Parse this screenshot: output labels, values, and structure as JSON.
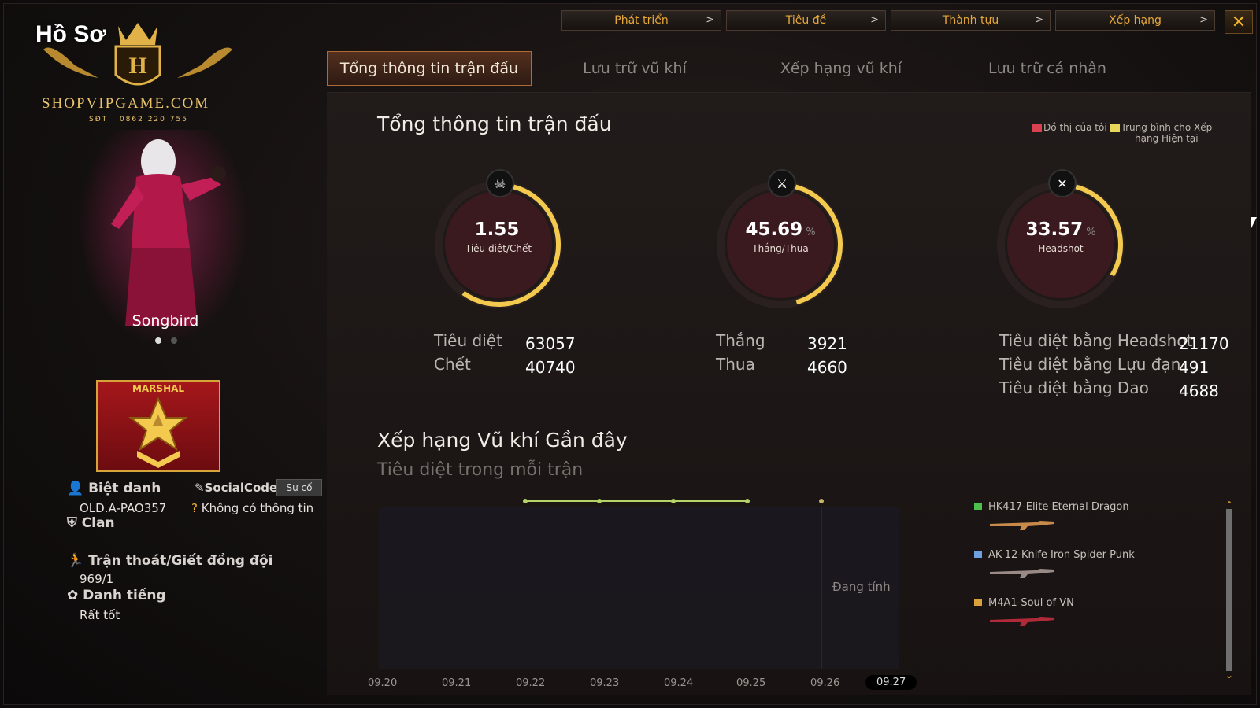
{
  "top_nav": [
    {
      "label": "Phát triển",
      "chevron": ">"
    },
    {
      "label": "Tiêu đề",
      "chevron": ">"
    },
    {
      "label": "Thành tựu",
      "chevron": ">"
    },
    {
      "label": "Xếp hạng",
      "chevron": ">"
    }
  ],
  "close_label": "✕",
  "tabs": [
    {
      "label": "Tổng thông tin trận đấu",
      "active": true
    },
    {
      "label": "Lưu trữ vũ khí",
      "active": false
    },
    {
      "label": "Xếp hạng vũ khí",
      "active": false
    },
    {
      "label": "Lưu trữ cá nhân",
      "active": false
    }
  ],
  "profile": {
    "window_title": "Hồ Sơ",
    "watermark_site": "SHOPVIPGAME.COM",
    "watermark_phone": "SĐT : 0862 220 755",
    "character_name": "Songbird",
    "carousel_pages": 2,
    "carousel_current": 1,
    "rank": "MARSHAL",
    "nickname_label": "Biệt danh",
    "nickname": "OLD.A-PAO357",
    "socialcode_label": "SocialCode",
    "suco_button": "Sự cố",
    "socialcode_value": "Không có thông tin",
    "clan_label": "Clan",
    "escape_label": "Trận thoát/Giết đồng đội",
    "escape_value": "969/1",
    "reputation_label": "Danh tiếng",
    "reputation_value": "Rất tốt"
  },
  "main": {
    "title": "Tổng thông tin trận đấu",
    "legend": {
      "mine": "Đồ thị của tôi",
      "average_line1": "Trung bình cho Xếp",
      "average_line2": "hạng Hiện tại"
    },
    "gauges": [
      {
        "value": "1.55",
        "unit": "",
        "label": "Tiêu diệt/Chết",
        "icon": "skull-icon",
        "glyph": "☠",
        "fraction": 0.6
      },
      {
        "value": "45.69",
        "unit": "%",
        "label": "Thắng/Thua",
        "icon": "crossed-swords-icon",
        "glyph": "⚔",
        "fraction": 0.4569
      },
      {
        "value": "33.57",
        "unit": "%",
        "label": "Headshot",
        "icon": "crossed-gun-icon",
        "glyph": "✕",
        "fraction": 0.3357
      }
    ],
    "stats_kd": [
      {
        "label": "Tiêu diệt",
        "value": "63057"
      },
      {
        "label": "Chết",
        "value": "40740"
      }
    ],
    "stats_wl": [
      {
        "label": "Thắng",
        "value": "3921"
      },
      {
        "label": "Thua",
        "value": "4660"
      }
    ],
    "stats_kills": [
      {
        "label": "Tiêu diệt bằng Headshot",
        "value": "21170"
      },
      {
        "label": "Tiêu diệt bằng Lựu đạn",
        "value": "491"
      },
      {
        "label": "Tiêu diệt bằng Dao",
        "value": "4688"
      }
    ],
    "weapons_title": "Xếp hạng Vũ khí Gần đây",
    "weapons_subtitle": "Tiêu diệt trong mỗi trận",
    "calculating": "Đang tính",
    "dates": [
      "09.20",
      "09.21",
      "09.22",
      "09.23",
      "09.24",
      "09.25",
      "09.26",
      "09.27"
    ],
    "current_date": "09.27",
    "weapons": [
      {
        "name": "HK417-Elite Eternal Dragon",
        "color": "#4cc24c"
      },
      {
        "name": "AK-12-Knife Iron Spider Punk",
        "color": "#6fa0e0"
      },
      {
        "name": "M4A1-Soul of VN",
        "color": "#d9a23a"
      }
    ]
  },
  "colors": {
    "accent": "#e7a83a",
    "line": "#b6d36a",
    "ring_start": "#e05a3a",
    "ring_end": "#f3c94e"
  }
}
